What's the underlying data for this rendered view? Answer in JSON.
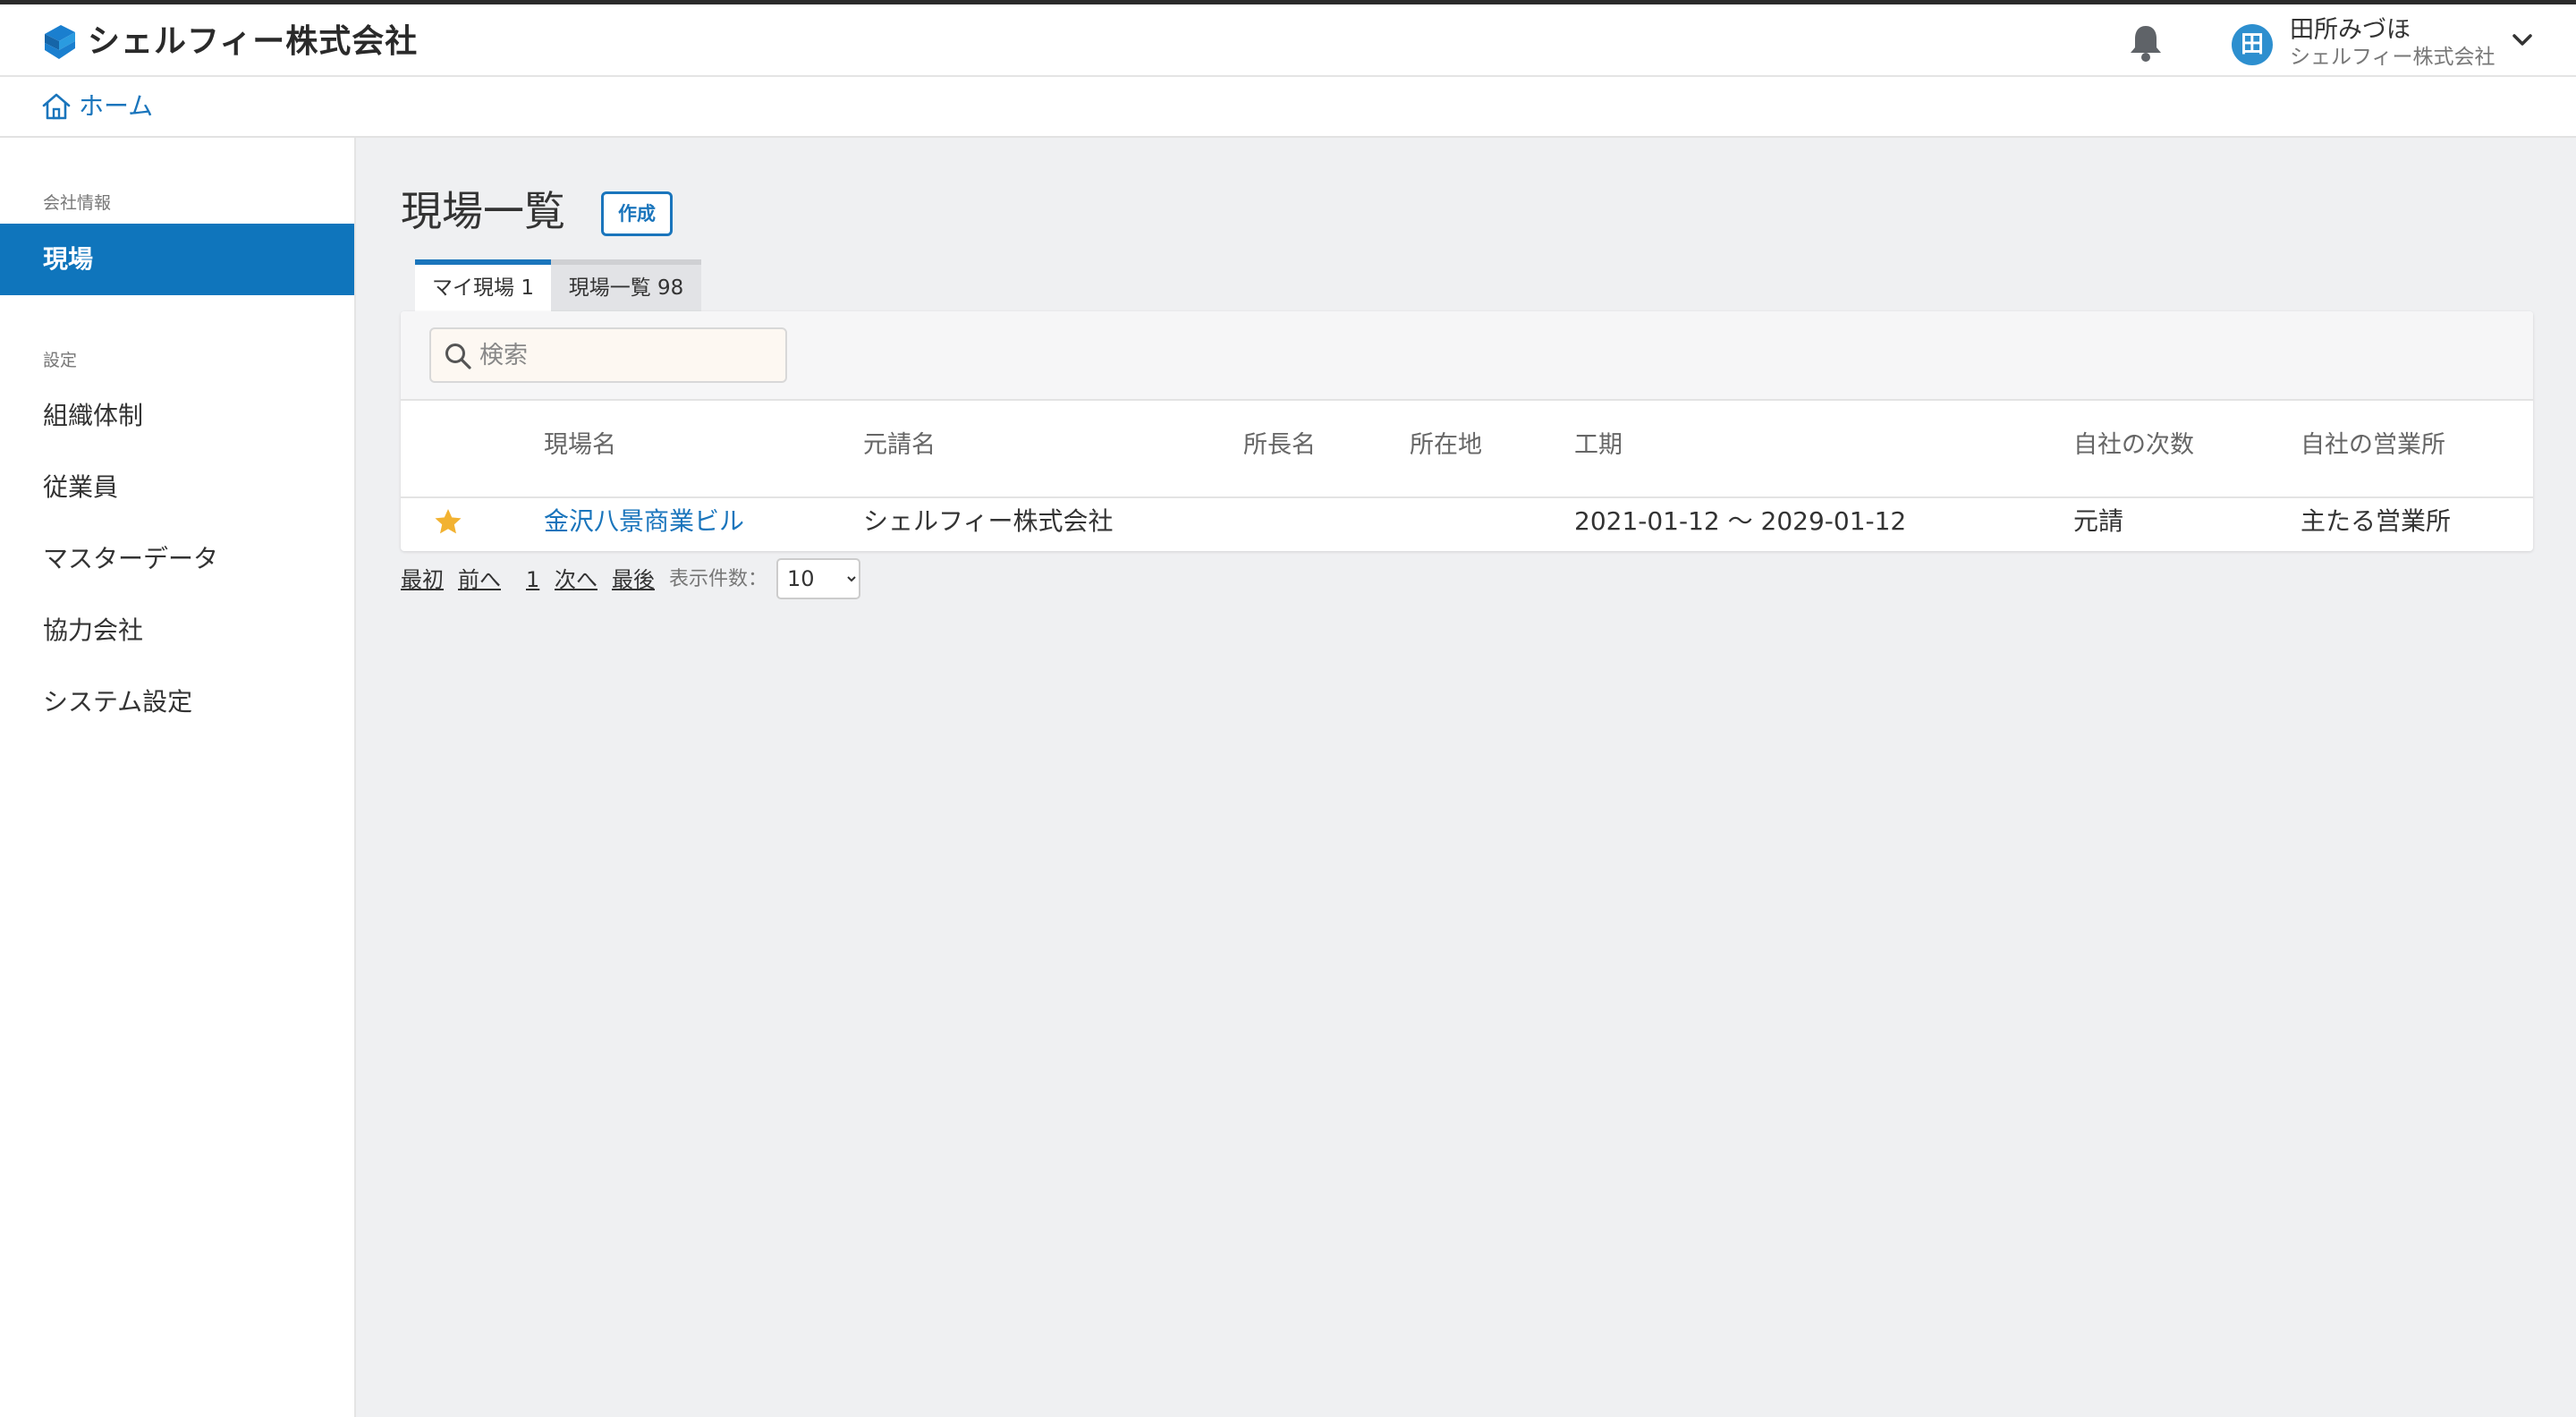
{
  "header": {
    "brand": "シェルフィー株式会社",
    "user": {
      "avatar_initial": "田",
      "name": "田所みづほ",
      "company": "シェルフィー株式会社"
    }
  },
  "breadcrumb": {
    "home": "ホーム"
  },
  "sidebar": {
    "section_company": "会社情報",
    "section_settings": "設定",
    "items": [
      {
        "label": "現場",
        "active": true
      },
      {
        "label": "組織体制"
      },
      {
        "label": "従業員"
      },
      {
        "label": "マスターデータ"
      },
      {
        "label": "協力会社"
      },
      {
        "label": "システム設定"
      }
    ]
  },
  "main": {
    "title": "現場一覧",
    "create_label": "作成",
    "tabs": [
      {
        "label": "マイ現場 1",
        "active": true
      },
      {
        "label": "現場一覧 98",
        "active": false
      }
    ],
    "search": {
      "placeholder": "検索",
      "value": ""
    },
    "table": {
      "columns": [
        "現場名",
        "元請名",
        "所長名",
        "所在地",
        "工期",
        "自社の次数",
        "自社の営業所"
      ],
      "rows": [
        {
          "favorite": true,
          "site_name": "金沢八景商業ビル",
          "prime_contractor": "シェルフィー株式会社",
          "manager": "",
          "location": "",
          "period": "2021-01-12 〜 2029-01-12",
          "tier": "元請",
          "office": "主たる営業所"
        }
      ]
    },
    "pagination": {
      "first": "最初",
      "prev": "前へ",
      "page": "1",
      "next": "次へ",
      "last": "最後",
      "per_page_label": "表示件数：",
      "per_page_value": "10"
    }
  },
  "colors": {
    "accent": "#1a75bc",
    "active_nav": "#0f75bc",
    "star": "#f2b231",
    "background": "#eff0f2"
  }
}
